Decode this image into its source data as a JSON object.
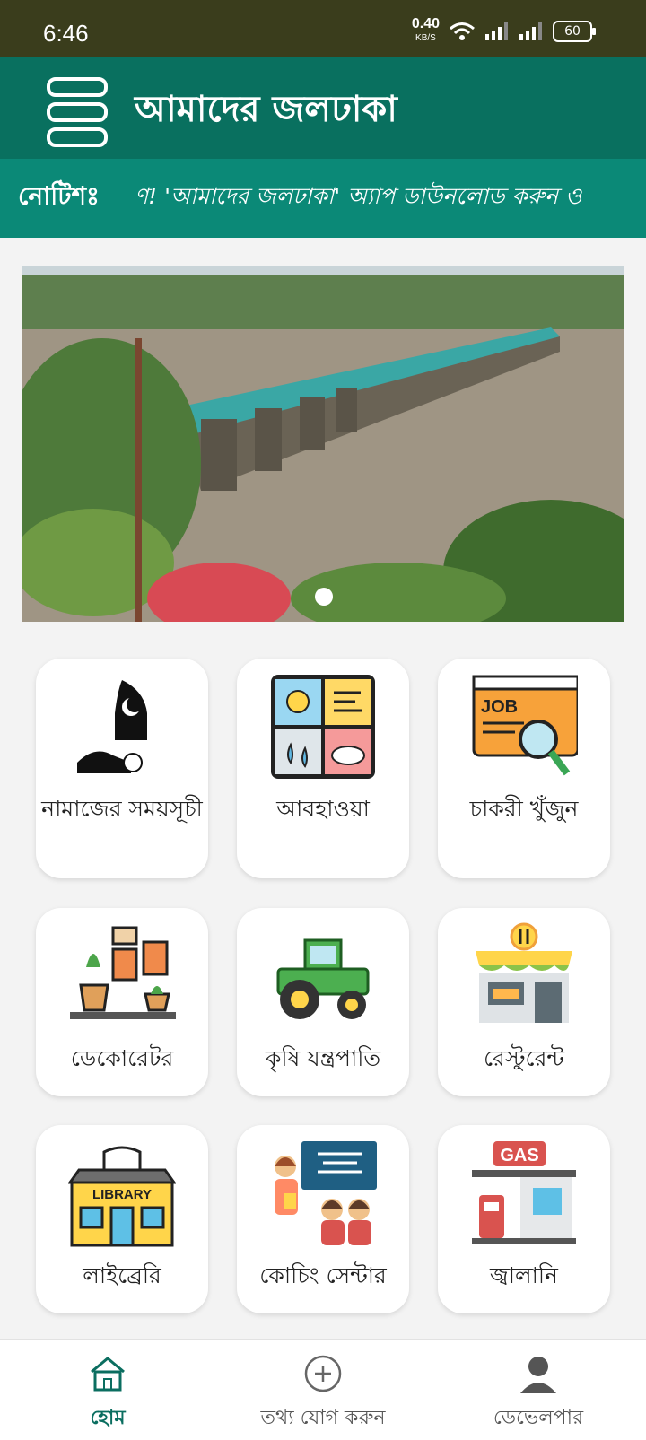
{
  "status_bar": {
    "time": "6:46",
    "net_speed": "0.40",
    "net_unit": "KB/S",
    "battery": "60"
  },
  "app_bar": {
    "title": "আমাদের জলঢাকা"
  },
  "notice": {
    "label": "নোটিশঃ",
    "text": "ণ! 'আমাদের জলঢাকা' অ্যাপ ডাউনলোড করুন ও"
  },
  "grid": [
    {
      "label": "নামাজের সময়সূচী",
      "icon": "prayer-times-icon"
    },
    {
      "label": "আবহাওয়া",
      "icon": "weather-icon"
    },
    {
      "label": "চাকরী খুঁজুন",
      "icon": "job-search-icon"
    },
    {
      "label": "ডেকোরেটর",
      "icon": "decorator-icon"
    },
    {
      "label": "কৃষি যন্ত্রপাতি",
      "icon": "tractor-icon"
    },
    {
      "label": "রেস্টুরেন্ট",
      "icon": "restaurant-icon"
    },
    {
      "label": "লাইব্রেরি",
      "icon": "library-icon"
    },
    {
      "label": "কোচিং সেন্টার",
      "icon": "coaching-icon"
    },
    {
      "label": "জ্বালানি",
      "icon": "gas-station-icon"
    }
  ],
  "library_sign": "LIBRARY",
  "job_sign": "JOB",
  "gas_sign": "GAS",
  "bottom_nav": [
    {
      "label": "হোম",
      "icon": "home-icon",
      "active": true
    },
    {
      "label": "তথ্য যোগ করুন",
      "icon": "add-icon",
      "active": false
    },
    {
      "label": "ডেভেলপার",
      "icon": "developer-icon",
      "active": false
    }
  ],
  "colors": {
    "status_bar": "#3a3d1c",
    "app_bar": "#09705f",
    "notice_bar": "#0b8977",
    "accent": "#0b6e60"
  }
}
